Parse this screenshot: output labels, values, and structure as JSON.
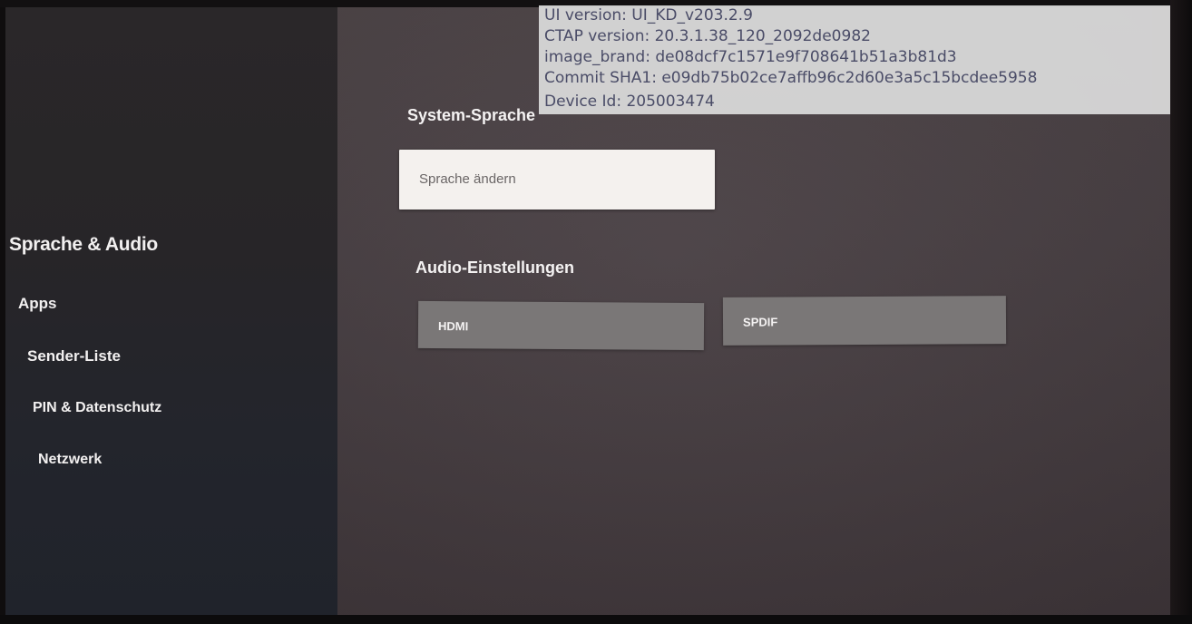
{
  "sidebar": {
    "items": [
      {
        "label": "Sprache & Audio",
        "active": true
      },
      {
        "label": "Apps"
      },
      {
        "label": "Sender-Liste"
      },
      {
        "label": "PIN & Datenschutz"
      },
      {
        "label": "Netzwerk"
      }
    ]
  },
  "main": {
    "system_language": {
      "title": "System-Sprache",
      "button_label": "Sprache ändern"
    },
    "audio_settings": {
      "title": "Audio-Einstellungen",
      "options": [
        {
          "label": "HDMI"
        },
        {
          "label": "SPDIF"
        }
      ]
    }
  },
  "debug_info": {
    "ui_version": "UI version: UI_KD_v203.2.9",
    "ctap_version": "CTAP version: 20.3.1.38_120_2092de0982",
    "image_brand": "image_brand: de08dcf7c1571e9f708641b51a3b81d3",
    "commit_sha1": "Commit SHA1: e09db75b02ce7affb96c2d60e3a5c15bcdee5958",
    "device_id": "Device Id: 205003474"
  },
  "colors": {
    "sidebar_bg": "#272528",
    "main_bg": "#4a4145",
    "primary_button_bg": "#f4f1ee",
    "secondary_button_bg": "#7a7777",
    "debug_overlay_bg": "#dcdcdc",
    "debug_text": "#4a4d6a"
  }
}
